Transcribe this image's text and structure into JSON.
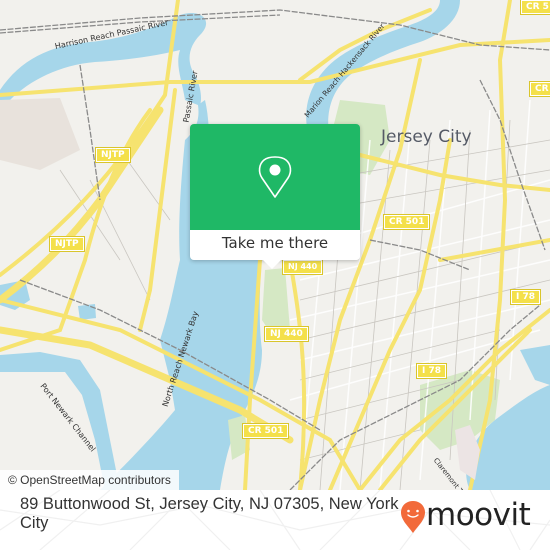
{
  "map": {
    "city_labels": [
      {
        "name": "jersey-city",
        "text": "Jersey City"
      }
    ],
    "water_labels": [
      {
        "name": "harrison-reach",
        "text": "Harrison Reach Passaic River"
      },
      {
        "name": "passaic-river",
        "text": "Passaic River"
      },
      {
        "name": "marion-reach",
        "text": "Marion Reach Hackensack River"
      },
      {
        "name": "north-reach-newark-bay",
        "text": "North Reach Newark Bay"
      },
      {
        "name": "port-newark-channel",
        "text": "Port Newark Channel"
      },
      {
        "name": "claremont-terminal",
        "text": "Claremont Te"
      }
    ],
    "shields": [
      {
        "name": "njtp-north",
        "text": "NJTP"
      },
      {
        "name": "njtp-south",
        "text": "NJTP"
      },
      {
        "name": "cr-501-north",
        "text": "CR 501"
      },
      {
        "name": "cr-501-south",
        "text": "CR 501"
      },
      {
        "name": "nj-440-north",
        "text": "NJ 440"
      },
      {
        "name": "nj-440-south",
        "text": "NJ 440"
      },
      {
        "name": "i-78-east",
        "text": "I 78"
      },
      {
        "name": "i-78-west",
        "text": "I 78"
      },
      {
        "name": "cr-top-right",
        "text": "CR 5"
      },
      {
        "name": "cr-right",
        "text": "CR"
      }
    ],
    "colors": {
      "land": "#f2f1ed",
      "water": "#a6d6ea",
      "park": "#d5e8c4",
      "road_major": "#f6e36f",
      "rail": "#8a8a8a",
      "popup_green": "#1fb866",
      "brand_orange": "#f26a3a"
    }
  },
  "popup": {
    "icon": "map-pin-icon",
    "button_label": "Take me there"
  },
  "attribution": "© OpenStreetMap contributors",
  "footer": {
    "address": "89 Buttonwood St, Jersey City, NJ 07305, New York City",
    "logo_text": "moovit",
    "logo_icon": "moovit-pin-smile-icon"
  }
}
